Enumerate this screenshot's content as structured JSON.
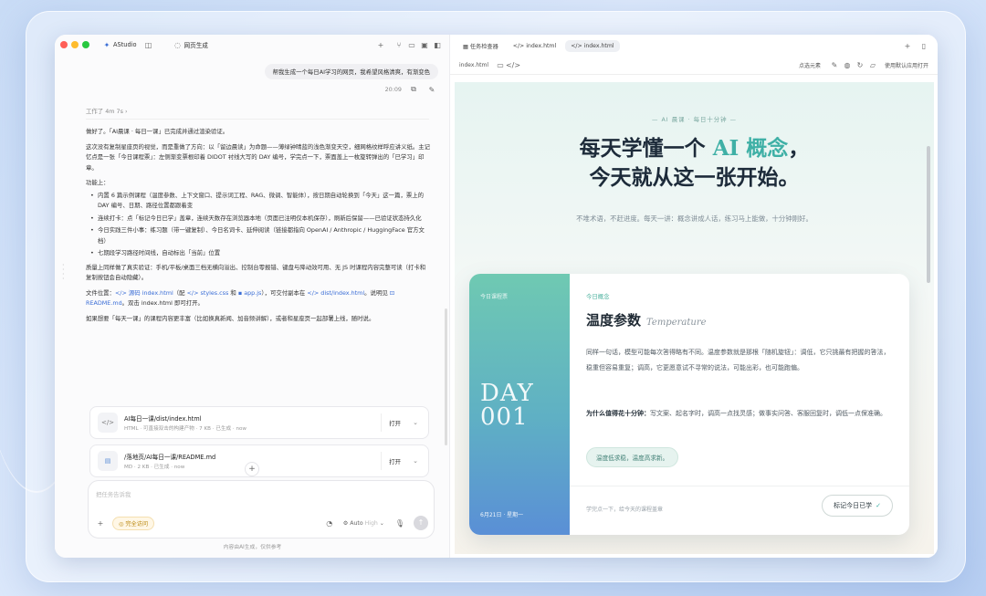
{
  "app": {
    "name": "AStudio",
    "tab_title": "网页生成"
  },
  "chat": {
    "user_message": "帮我生成一个每日AI学习的网页，我希望风格清爽，有渐变色",
    "message_time": "20:09",
    "worked": "工作了 4m 7s",
    "p1": "做好了。「AI晨课 · 每日一课」已完成并通过渲染验证。",
    "p2": "这次没有复制星座页的视觉，而是重做了方向：以「留边晨读」为命题——薄绿钟晴蓝的浅色渐变天空，细网格纹样呼应讲义纸。主记忆点是一张「今日课程票」：左侧渐变票根印着 DIDOT 衬线大写的 DAY 编号，学完点一下，票面盖上一枚旋转弹出的「已学习」印章。",
    "p3": "功能上：",
    "bullets": [
      "内置 6 篇示例课程（温度参数、上下文窗口、提示词工程、RAG、微调、智能体），按日期自动轮换到「今天」这一篇，票上的 DAY 编号、日期、路径位置都跟着变",
      "连续打卡：点「标记今日已学」盖章，连续天数存在浏览器本地（页面已注明仅本机保存），刷新后保留——已验证状态持久化",
      "今日实践三件小事：练习题（带一键复制）、今日名词卡、延伸阅读（链接都指向 OpenAI / Anthropic / HuggingFace 官方文档）",
      "七期段学习路径时间线，自动标出「当前」位置"
    ],
    "p4": "质量上同样做了真实验证：手机/平板/桌面三档无横向溢出、控制台零报错、键盘与降动效可用、无 JS 时课程内容完整可读（打卡和复制按钮会自动隐藏）。",
    "files_prefix": "文件位置：",
    "link_index": "源码 index.html",
    "files_mid1": "（配",
    "link_css": "styles.css",
    "files_and": "和",
    "link_js": "app.js",
    "files_mid2": "），可交付副本在",
    "link_dist": "dist/index.html",
    "files_mid3": "。说明见",
    "link_readme": "README.md",
    "files_end": "。双击 index.html 即可打开。",
    "p6": "如果想要「每天一课」的课程内容更丰富（比如换真新闻、加音频讲解），或者和星座页一起部署上线，随时说。"
  },
  "files": [
    {
      "name": "AI每日一课/dist/index.html",
      "meta": "HTML · 可直接双击的构建产物 · 7 KB · 已生成 · now",
      "open": "打开"
    },
    {
      "name": "/落地页/AI每日一课/README.md",
      "meta": "MD · 2 KB · 已生成 · now",
      "open": "打开"
    }
  ],
  "composer": {
    "placeholder": "把任务告诉我",
    "access": "完全访问",
    "model": "Auto",
    "level": "High"
  },
  "footnote": "内容由AI生成，仅供参考",
  "right_tabs": [
    "任务检查器",
    "index.html",
    "index.html"
  ],
  "toolbar": {
    "file": "index.html",
    "select": "点选元素",
    "open_default": "使用默认应用打开"
  },
  "page": {
    "kicker": "— AI 晨课 · 每日十分钟 —",
    "headline_1a": "每天学懂一个 ",
    "headline_1b": "AI 概念",
    "headline_1c": "，",
    "headline_2": "今天就从这一张开始。",
    "sub": "不堆术语，不赶进度。每天一讲：概念讲成人话，练习马上能做，十分钟刚好。",
    "card": {
      "side_top": "今日课程票",
      "day": "DAY",
      "num": "001",
      "date": "6月21日 · 星期一",
      "tag": "今日概念",
      "title": "温度参数",
      "title_en": "Temperature",
      "p1": "同样一句话，模型可能每次答得略有不同。温度参数就是那根「随机旋钮」：调低，它只挑最有把握的答法，稳重但容易重复；调高，它更愿意试不寻常的说法，可能出彩，也可能跑偏。",
      "p2_bold": "为什么值得花十分钟：",
      "p2": "写文案、起名字时，调高一点找灵感；做事实问答、客服回复时，调低一点保准确。",
      "chip": "温度低求稳，温度高求新。",
      "foot": "学完点一下，给今天的课程盖章",
      "button": "标记今日已学",
      "check": "✓"
    }
  },
  "colors": {
    "accent": "#3fb0a6",
    "link": "#3b6ed6",
    "red": "#ff5f57",
    "yellow": "#febc2e",
    "green": "#28c840"
  }
}
